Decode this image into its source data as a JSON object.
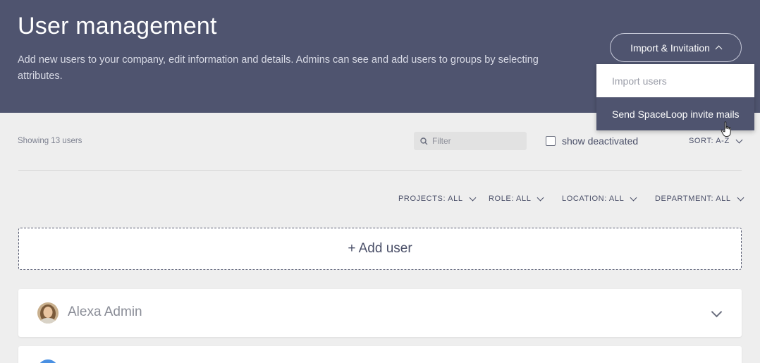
{
  "header": {
    "title": "User management",
    "description": "Add new users to your company, edit information and details. Admins can see and add users to groups by selecting attributes."
  },
  "import_button": {
    "label": "Import & Invitation"
  },
  "dropdown": {
    "items": [
      {
        "label": "Import users"
      },
      {
        "label": "Send SpaceLoop invite mails"
      }
    ]
  },
  "toolbar": {
    "showing": "Showing 13 users",
    "filter_placeholder": "Filter",
    "show_deactivated": "show deactivated",
    "sort_label": "SORT: A-Z"
  },
  "filters": {
    "projects": "PROJECTS: ALL",
    "role": "ROLE: ALL",
    "location": "LOCATION: ALL",
    "department": "DEPARTMENT: ALL"
  },
  "add_user_label": "+ Add user",
  "users": [
    {
      "name": "Alexa Admin"
    }
  ],
  "colors": {
    "header_bg": "#4f546f",
    "page_bg": "#eeeeee",
    "accent_avatar": "#4a90e2"
  }
}
